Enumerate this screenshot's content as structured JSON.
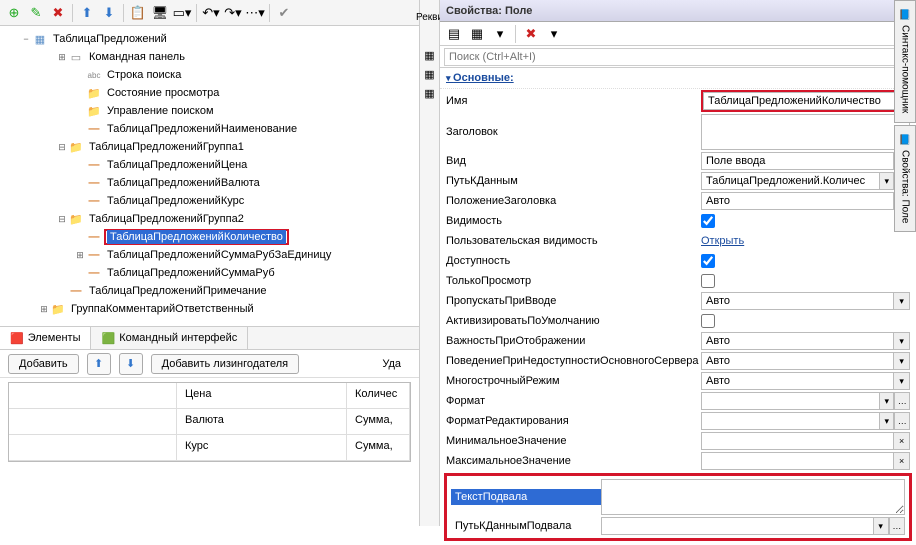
{
  "toolbar_icons": [
    "➕",
    "✏️",
    "✖",
    "⬆",
    "⬇",
    "📋",
    "🖥",
    "📑",
    "↶",
    "↷",
    "⋯",
    "✔"
  ],
  "tree": {
    "root": "ТаблицаПредложений",
    "children": [
      {
        "label": "Командная панель",
        "icon": "cmd",
        "indent": 2,
        "exp": "+"
      },
      {
        "label": "Строка поиска",
        "icon": "abc",
        "indent": 3
      },
      {
        "label": "Состояние просмотра",
        "icon": "folder",
        "indent": 3
      },
      {
        "label": "Управление поиском",
        "icon": "folder",
        "indent": 3
      },
      {
        "label": "ТаблицаПредложенийНаименование",
        "icon": "dash",
        "indent": 3
      },
      {
        "label": "ТаблицаПредложенийГруппа1",
        "icon": "folder",
        "indent": 2,
        "exp": "−"
      },
      {
        "label": "ТаблицаПредложенийЦена",
        "icon": "dash",
        "indent": 3
      },
      {
        "label": "ТаблицаПредложенийВалюта",
        "icon": "dash",
        "indent": 3
      },
      {
        "label": "ТаблицаПредложенийКурс",
        "icon": "dash",
        "indent": 3
      },
      {
        "label": "ТаблицаПредложенийГруппа2",
        "icon": "folder",
        "indent": 2,
        "exp": "−"
      },
      {
        "label": "ТаблицаПредложенийКоличество",
        "icon": "dash",
        "indent": 3,
        "selected": true,
        "boxed": true
      },
      {
        "label": "ТаблицаПредложенийСуммаРубЗаЕдиницу",
        "icon": "dash",
        "indent": 3,
        "plus": true
      },
      {
        "label": "ТаблицаПредложенийСуммаРуб",
        "icon": "dash",
        "indent": 3
      },
      {
        "label": "ТаблицаПредложенийПримечание",
        "icon": "dash",
        "indent": 2
      },
      {
        "label": "ГруппаКомментарийОтветственный",
        "icon": "folder",
        "indent": 1,
        "exp": "+"
      }
    ]
  },
  "tabs": [
    {
      "label": "Элементы",
      "active": true,
      "icon": "🟥"
    },
    {
      "label": "Командный интерфейс",
      "active": false,
      "icon": "🟩"
    }
  ],
  "stub_tab": "Рекви",
  "actions": {
    "add": "Добавить",
    "add2": "Добавить лизингодателя",
    "del": "Уда"
  },
  "grid": {
    "header": [
      "",
      "Цена",
      "Количес"
    ],
    "rows": [
      [
        "",
        "Валюта",
        "Сумма,"
      ],
      [
        "",
        "Курс",
        "Сумма,"
      ]
    ]
  },
  "props": {
    "title": "Свойства: Поле",
    "search_ph": "Поиск (Ctrl+Alt+I)",
    "section": "Основные:",
    "rows": [
      {
        "label": "Имя",
        "type": "text",
        "value": "ТаблицаПредложенийКоличество",
        "boxed": true
      },
      {
        "label": "Заголовок",
        "type": "multiline",
        "value": ""
      },
      {
        "label": "Вид",
        "type": "combo",
        "value": "Поле ввода"
      },
      {
        "label": "ПутьКДанным",
        "type": "combo2",
        "value": "ТаблицаПредложений.Количес"
      },
      {
        "label": "ПоложениеЗаголовка",
        "type": "combo",
        "value": "Авто"
      },
      {
        "label": "Видимость",
        "type": "check",
        "checked": true
      },
      {
        "label": "Пользовательская видимость",
        "type": "link",
        "value": "Открыть"
      },
      {
        "label": "Доступность",
        "type": "check",
        "checked": true
      },
      {
        "label": "ТолькоПросмотр",
        "type": "check",
        "checked": false
      },
      {
        "label": "ПропускатьПриВводе",
        "type": "combo",
        "value": "Авто"
      },
      {
        "label": "АктивизироватьПоУмолчанию",
        "type": "check",
        "checked": false
      },
      {
        "label": "ВажностьПриОтображении",
        "type": "combo",
        "value": "Авто"
      },
      {
        "label": "ПоведениеПриНедоступностиОсновногоСервера",
        "type": "combo",
        "value": "Авто"
      },
      {
        "label": "МногострочныйРежим",
        "type": "combo",
        "value": "Авто"
      },
      {
        "label": "Формат",
        "type": "combo2",
        "value": ""
      },
      {
        "label": "ФорматРедактирования",
        "type": "combo2",
        "value": ""
      },
      {
        "label": "МинимальноеЗначение",
        "type": "clear",
        "value": ""
      },
      {
        "label": "МаксимальноеЗначение",
        "type": "clear",
        "value": ""
      }
    ],
    "footer": [
      {
        "label": "ТекстПодвала",
        "selected": true,
        "type": "multiline"
      },
      {
        "label": "ПутьКДаннымПодвала",
        "type": "combo2"
      }
    ]
  },
  "side_tabs": [
    "Синтакс-помощник",
    "Свойства: Поле"
  ]
}
